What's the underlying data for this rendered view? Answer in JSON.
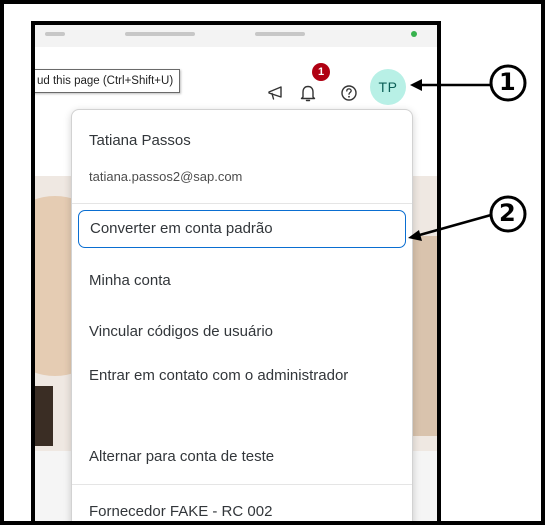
{
  "tooltip": {
    "text": "ud this page (Ctrl+Shift+U)"
  },
  "shellbar": {
    "notification_count": "1",
    "avatar_initials": "TP",
    "icons": [
      "megaphone-icon",
      "bell-icon",
      "help-icon"
    ]
  },
  "user_menu": {
    "name": "Tatiana Passos",
    "email": "tatiana.passos2@sap.com",
    "items": [
      {
        "label": "Converter em conta padrão"
      },
      {
        "label": "Minha conta"
      },
      {
        "label": "Vincular códigos de usuário"
      },
      {
        "label": "Entrar em contato com o administrador"
      },
      {
        "label": "Alternar para conta de teste"
      },
      {
        "label": "Fornecedor FAKE - RC 002"
      }
    ]
  },
  "callouts": {
    "one": "1",
    "two": "2"
  },
  "colors": {
    "accent": "#0a6ed1",
    "badge": "#b00012",
    "avatar_bg": "#b8f0e6"
  }
}
